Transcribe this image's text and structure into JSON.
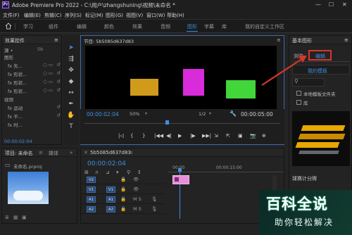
{
  "titlebar": {
    "logo": "Pr",
    "title": "Adobe Premiere Pro 2022 - C:\\用户\\zhangshuning\\视频\\未命名 *",
    "minimize": "—",
    "maximize": "☐",
    "close": "✕"
  },
  "menu": [
    "文件(F)",
    "编辑(E)",
    "剪辑(C)",
    "序列(S)",
    "标记(M)",
    "图形(G)",
    "视图(V)",
    "窗口(W)",
    "帮助(H)"
  ],
  "workspaces": [
    "学习",
    "组件",
    "编辑",
    "颜色",
    "效果",
    "音频",
    "图形",
    "字幕",
    "库",
    "我的自定义工作区"
  ],
  "active_workspace": "图形",
  "effect_controls": {
    "tab": "效果控件",
    "menu": "≡",
    "source": "源 •",
    "seq": "5b",
    "time": "00:00:02:04",
    "rows": [
      {
        "label": "图形",
        "ind": 1,
        "left": "",
        "right": ""
      },
      {
        "label": "fx  矢...",
        "ind": 2,
        "left": "○ ▭",
        "right": "↺"
      },
      {
        "label": "fx  形状...",
        "ind": 2,
        "left": "○ ▭",
        "right": "↺"
      },
      {
        "label": "fx  形状...",
        "ind": 2,
        "left": "○ ▭",
        "right": "↺"
      },
      {
        "label": "fx  形状...",
        "ind": 2,
        "left": "○ ▭",
        "right": "↺"
      },
      {
        "label": "视频",
        "ind": 1,
        "left": "",
        "right": ""
      },
      {
        "label": "fx  运动",
        "ind": 2,
        "left": "",
        "right": "↺"
      },
      {
        "label": "fx  不...",
        "ind": 2,
        "left": "",
        "right": "↺"
      },
      {
        "label": "fx  时...",
        "ind": 2,
        "left": "",
        "right": ""
      }
    ]
  },
  "program_monitor": {
    "tab": "节目: 5b5085d637d83",
    "menu": "≡",
    "timecode": "00:00:02:04",
    "zoom": "50%",
    "quality": "1/2",
    "duration": "00:00:05:00"
  },
  "transport": [
    "|◁",
    "{",
    "}",
    "|◀◀",
    "◀|",
    "▶",
    "|▶",
    "▶▶|",
    "⇲",
    "⇱",
    "▣",
    "📷",
    "⊕"
  ],
  "essential_graphics": {
    "tab": "基本图形",
    "menu": "≡",
    "tabs": [
      "浏览",
      "编辑"
    ],
    "active_tab": "编辑",
    "my_templates": "我的模板",
    "local_folder": "本地模板文件夹",
    "lib": "库",
    "countdown": "球赛计分牌"
  },
  "project": {
    "tab": "项目: 未命名",
    "menu": "≡",
    "tab2": "媒体",
    "tab_more": "»",
    "file": "未命名.prproj"
  },
  "timeline": {
    "tab": "5b5085d637d83",
    "menu": "≡",
    "timecode": "00:00:02:04",
    "ruler": [
      "00:00",
      "00:00:15:00"
    ],
    "tracks": [
      {
        "a": "V2",
        "b": "",
        "s": ""
      },
      {
        "a": "V1",
        "b": "V1",
        "s": ""
      },
      {
        "a": "A1",
        "b": "A1",
        "s": "M S"
      },
      {
        "a": "A2",
        "b": "A2",
        "s": "M S"
      }
    ]
  },
  "watermark": {
    "big": "百科全说",
    "small": "助你轻松解决"
  },
  "colors": {
    "accent": "#3d8fe0",
    "highlight": "#d9362a",
    "clip": "#e78ed9"
  }
}
